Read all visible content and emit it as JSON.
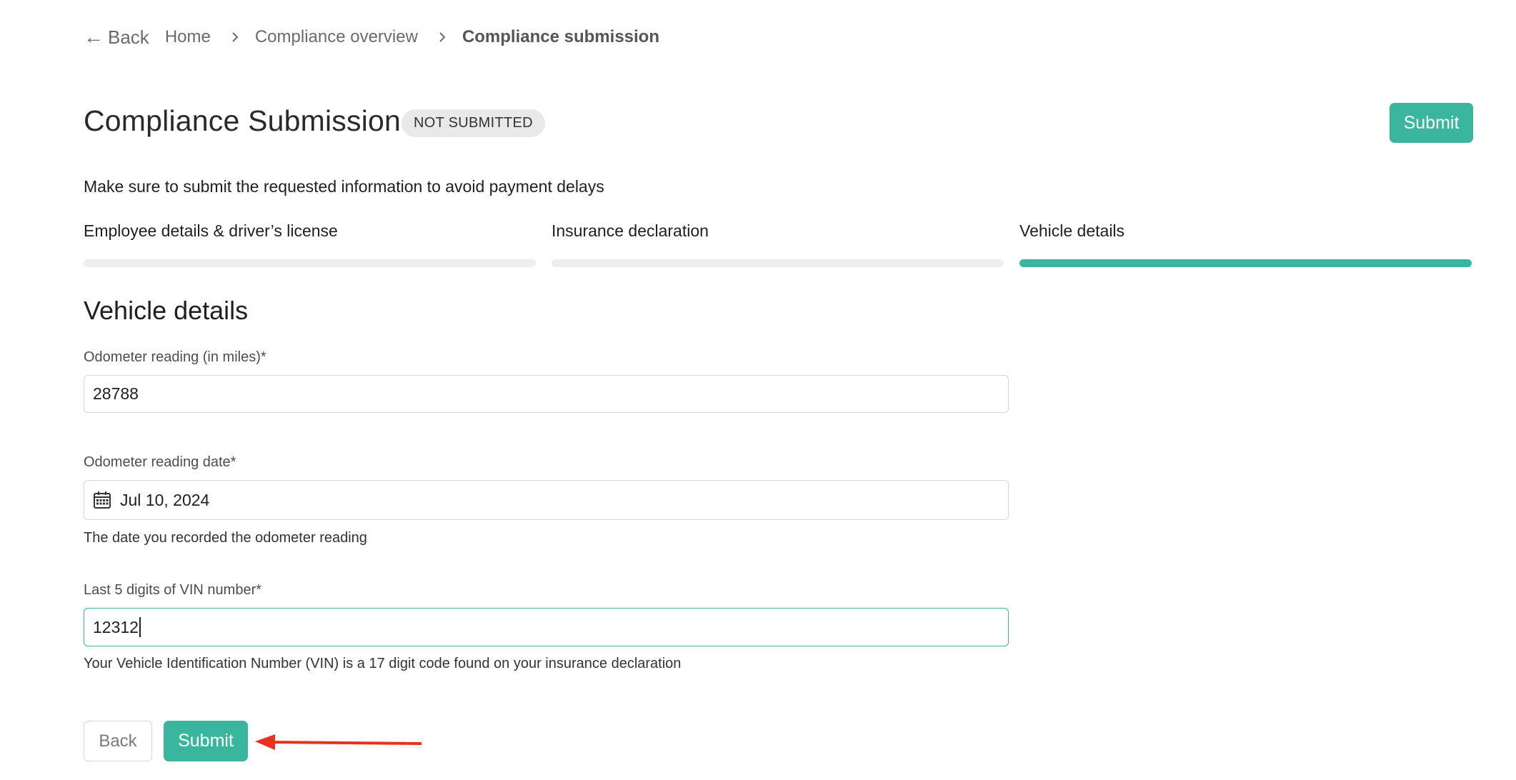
{
  "breadcrumb": {
    "back_label": "Back",
    "items": [
      "Home",
      "Compliance overview",
      "Compliance submission"
    ]
  },
  "header": {
    "title": "Compliance Submission",
    "status_badge": "NOT SUBMITTED",
    "submit_label": "Submit",
    "subtitle": "Make sure to submit the requested information to avoid payment delays"
  },
  "steps": [
    {
      "label": "Employee details & driver’s license",
      "active": false
    },
    {
      "label": "Insurance declaration",
      "active": false
    },
    {
      "label": "Vehicle details",
      "active": true
    }
  ],
  "form": {
    "section_title": "Vehicle details",
    "odometer": {
      "label": "Odometer reading (in miles)*",
      "value": "28788"
    },
    "odometer_date": {
      "label": "Odometer reading date*",
      "value": "Jul 10, 2024",
      "helper": "The date you recorded the odometer reading"
    },
    "vin": {
      "label": "Last 5 digits of VIN number*",
      "value": "12312",
      "helper": "Your Vehicle Identification Number (VIN) is a 17 digit code found on your insurance declaration"
    }
  },
  "actions": {
    "back_label": "Back",
    "submit_label": "Submit"
  },
  "colors": {
    "accent": "#3ab59e",
    "annotation_arrow": "#e8321f"
  },
  "icons": {
    "back": "arrow-left-icon",
    "separator": "chevron-right-icon",
    "date": "calendar-icon"
  }
}
